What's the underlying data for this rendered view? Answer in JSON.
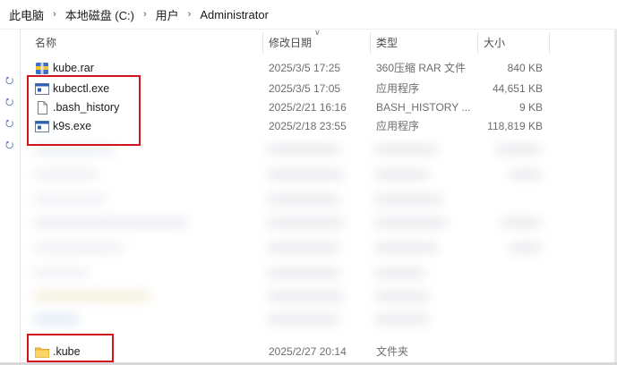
{
  "breadcrumb": [
    "此电脑",
    "本地磁盘 (C:)",
    "用户",
    "Administrator"
  ],
  "columns": {
    "name": "名称",
    "date": "修改日期",
    "type": "类型",
    "size": "大小"
  },
  "files": [
    {
      "name": "kube.rar",
      "date": "2025/3/5 17:25",
      "type": "360压缩 RAR 文件",
      "size": "840 KB",
      "icon": "rar-archive-icon"
    },
    {
      "name": "kubectl.exe",
      "date": "2025/3/5 17:05",
      "type": "应用程序",
      "size": "44,651 KB",
      "icon": "exe-icon"
    },
    {
      "name": ".bash_history",
      "date": "2025/2/21 16:16",
      "type": "BASH_HISTORY ...",
      "size": "9 KB",
      "icon": "file-icon"
    },
    {
      "name": "k9s.exe",
      "date": "2025/2/18 23:55",
      "type": "应用程序",
      "size": "118,819 KB",
      "icon": "exe-icon"
    }
  ],
  "bottom_file": {
    "name": ".kube",
    "date": "2025/2/27 20:14",
    "type": "文件夹",
    "size": "",
    "icon": "folder-icon"
  },
  "colors": {
    "highlight_box": "#d0151f",
    "folder": "#f5c342",
    "exe_blue": "#2b62b5"
  }
}
